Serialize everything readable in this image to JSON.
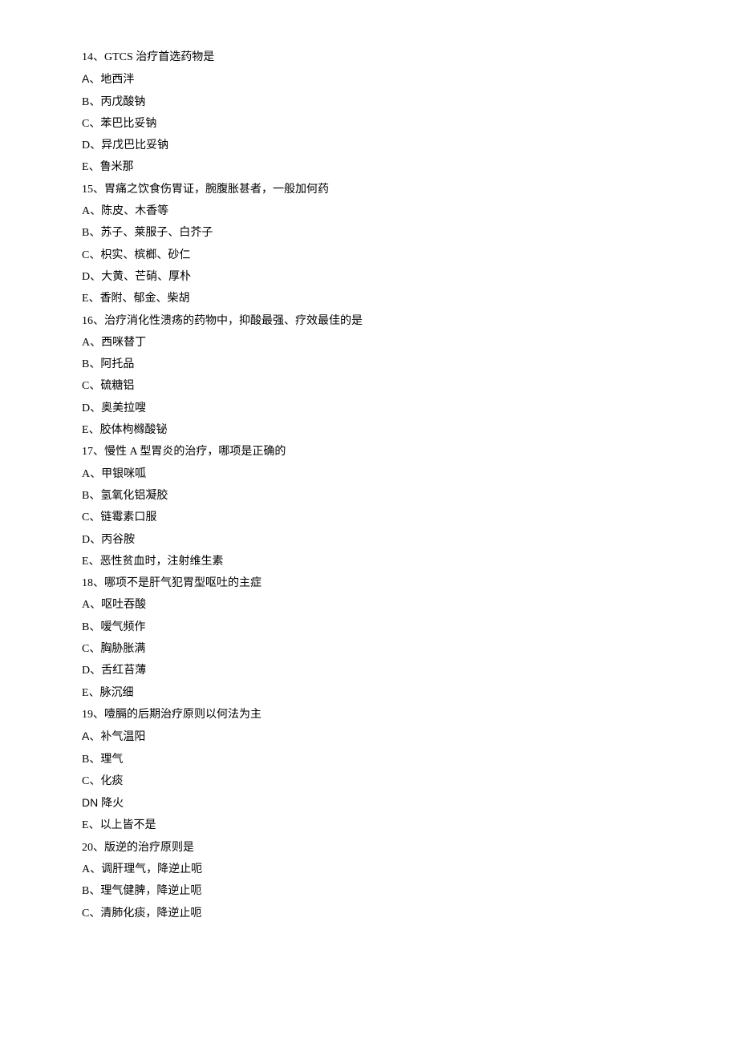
{
  "questions": [
    {
      "num": "14",
      "stem": "GTCS 治疗首选药物是",
      "options": [
        {
          "letter": "A",
          "text": "地西泮",
          "sans": true
        },
        {
          "letter": "B",
          "text": "丙戊酸钠"
        },
        {
          "letter": "C",
          "text": "苯巴比妥钠"
        },
        {
          "letter": "D",
          "text": "异戊巴比妥钠"
        },
        {
          "letter": "E",
          "text": "鲁米那"
        }
      ]
    },
    {
      "num": "15",
      "stem": "胃痛之饮食伤胃证，腕腹胀甚者，一般加何药",
      "options": [
        {
          "letter": "A",
          "text": "陈皮、木香等"
        },
        {
          "letter": "B",
          "text": "苏子、莱服子、白芥子"
        },
        {
          "letter": "C",
          "text": "枳实、槟榔、砂仁"
        },
        {
          "letter": "D",
          "text": "大黄、芒硝、厚朴"
        },
        {
          "letter": "E",
          "text": "香附、郁金、柴胡"
        }
      ]
    },
    {
      "num": "16",
      "stem": "治疗消化性溃疡的药物中，抑酸最强、疗效最佳的是",
      "options": [
        {
          "letter": "A",
          "text": "西咪替丁"
        },
        {
          "letter": "B",
          "text": "阿托品"
        },
        {
          "letter": "C",
          "text": "硫糖铝"
        },
        {
          "letter": "D",
          "text": "奥美拉嗖"
        },
        {
          "letter": "E",
          "text": "胶体枸橼酸铋"
        }
      ]
    },
    {
      "num": "17",
      "stem": "慢性 A 型胃炎的治疗，哪项是正确的",
      "options": [
        {
          "letter": "A",
          "text": "甲银咪呱"
        },
        {
          "letter": "B",
          "text": "氢氧化铝凝胶"
        },
        {
          "letter": "C",
          "text": "链霉素口服"
        },
        {
          "letter": "D",
          "text": "丙谷胺"
        },
        {
          "letter": "E",
          "text": "恶性贫血时，注射维生素"
        }
      ]
    },
    {
      "num": "18",
      "stem": "哪项不是肝气犯胃型呕吐的主症",
      "options": [
        {
          "letter": "A",
          "text": "呕吐吞酸"
        },
        {
          "letter": "B",
          "text": "嗳气频作"
        },
        {
          "letter": "C",
          "text": "胸胁胀满"
        },
        {
          "letter": "D",
          "text": "舌红苔薄"
        },
        {
          "letter": "E",
          "text": "脉沉细"
        }
      ]
    },
    {
      "num": "19",
      "stem": "噎膈的后期治疗原则以何法为主",
      "options": [
        {
          "letter": "A",
          "text": "补气温阳",
          "sans": true
        },
        {
          "letter": "B",
          "text": "理气"
        },
        {
          "letter": "C",
          "text": "化痰"
        },
        {
          "letter": "DN",
          "text": "降火",
          "run": true
        },
        {
          "letter": "E",
          "text": "以上皆不是"
        }
      ]
    },
    {
      "num": "20",
      "stem": "版逆的治疗原则是",
      "options": [
        {
          "letter": "A",
          "text": "调肝理气，降逆止呃"
        },
        {
          "letter": "B",
          "text": "理气健脾，降逆止呃"
        },
        {
          "letter": "C",
          "text": "清肺化痰，降逆止呃"
        }
      ]
    }
  ]
}
